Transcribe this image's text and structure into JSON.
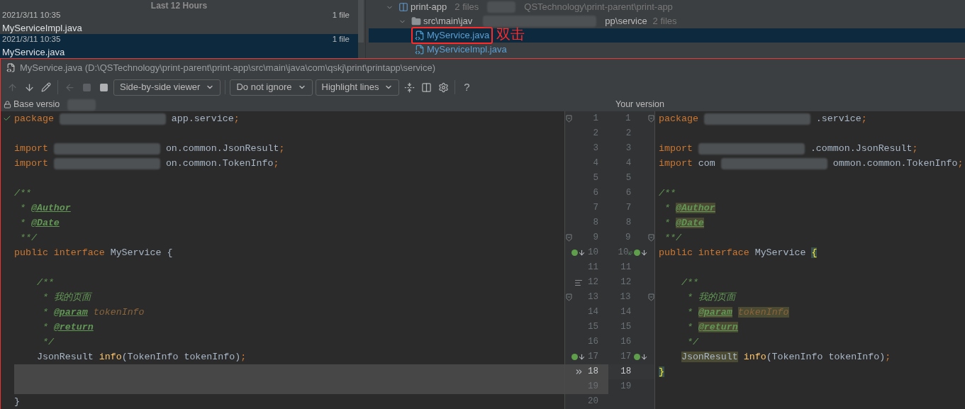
{
  "history": {
    "header": "Last 12 Hours",
    "items": [
      {
        "date": "2021/3/11 10:35",
        "count": "1 file",
        "name": "MyServiceImpl.java",
        "selected": false
      },
      {
        "date": "2021/3/11 10:35",
        "count": "1 file",
        "name": "MyService.java",
        "selected": true
      }
    ]
  },
  "tree": [
    {
      "kind": "module",
      "label": "print-app",
      "count": "2 files",
      "path": "QSTechnology\\print-parent\\print-app",
      "expanded": true,
      "children": [
        {
          "kind": "folder",
          "label": "src\\main\\jav",
          "path": "pp\\service",
          "count": "2 files",
          "expanded": true,
          "children": [
            {
              "kind": "file",
              "label": "MyService.java",
              "selected": true,
              "annotated": true
            },
            {
              "kind": "file",
              "label": "MyServiceImpl.java",
              "selected": false,
              "annotated": false
            }
          ]
        }
      ]
    }
  ],
  "annotation": "双击",
  "diff": {
    "title": "MyService.java",
    "path": "(D:\\QSTechnology\\print-parent\\print-app\\src\\main\\java\\com\\qskj\\print\\printapp\\service)",
    "toolbar": [
      {
        "kind": "up",
        "disabled": true
      },
      {
        "kind": "down",
        "disabled": false
      },
      {
        "kind": "edit",
        "disabled": false
      },
      {
        "kind": "separator"
      },
      {
        "kind": "back",
        "disabled": true
      },
      {
        "kind": "square",
        "disabled": true
      },
      {
        "kind": "square",
        "disabled": false
      },
      {
        "kind": "dropdown",
        "label": "Side-by-side viewer"
      },
      {
        "kind": "separator"
      },
      {
        "kind": "dropdown",
        "label": "Do not ignore"
      },
      {
        "kind": "dropdown",
        "label": "Highlight lines"
      },
      {
        "kind": "collapse"
      },
      {
        "kind": "columns"
      },
      {
        "kind": "settings"
      },
      {
        "kind": "separator"
      },
      {
        "kind": "help",
        "label": "?"
      }
    ],
    "left_header": "Base versio",
    "right_header": "Your version",
    "left_lines": [
      {
        "changed": false,
        "tokens": [
          {
            "kind": "kw",
            "text": "package"
          },
          {
            "kind": "blur"
          },
          {
            "kind": "plain",
            "text": "app.service"
          },
          {
            "kind": "semi",
            "text": ";"
          }
        ]
      },
      {
        "changed": false
      },
      {
        "changed": false,
        "tokens": [
          {
            "kind": "kw",
            "text": "import"
          },
          {
            "kind": "blur"
          },
          {
            "kind": "plain",
            "text": "on.common.JsonResult"
          },
          {
            "kind": "semi",
            "text": ";"
          }
        ]
      },
      {
        "changed": false,
        "tokens": [
          {
            "kind": "kw",
            "text": "import"
          },
          {
            "kind": "blur"
          },
          {
            "kind": "plain",
            "text": "on.common.TokenInfo"
          },
          {
            "kind": "semi",
            "text": ";"
          }
        ]
      },
      {
        "changed": false
      },
      {
        "changed": false,
        "tokens": [
          {
            "kind": "cmt",
            "text": "/**"
          }
        ]
      },
      {
        "changed": false,
        "tokens": [
          {
            "kind": "cmt",
            "text": " * "
          },
          {
            "kind": "tag",
            "text": "@Author"
          }
        ]
      },
      {
        "changed": false,
        "tokens": [
          {
            "kind": "cmt",
            "text": " * "
          },
          {
            "kind": "tag",
            "text": "@Date"
          }
        ]
      },
      {
        "changed": false,
        "tokens": [
          {
            "kind": "cmt",
            "text": " **/"
          }
        ]
      },
      {
        "changed": false,
        "tokens": [
          {
            "kind": "kw",
            "text": "public interface "
          },
          {
            "kind": "plain",
            "text": "MyService {"
          }
        ]
      },
      {
        "changed": false
      },
      {
        "changed": false,
        "tokens": [
          {
            "kind": "cmt",
            "text": "    /**"
          }
        ]
      },
      {
        "changed": false,
        "tokens": [
          {
            "kind": "cmt",
            "text": "     * 我的页面"
          }
        ]
      },
      {
        "changed": false,
        "tokens": [
          {
            "kind": "cmt",
            "text": "     * "
          },
          {
            "kind": "tag",
            "text": "@param"
          },
          {
            "kind": "param",
            "text": " tokenInfo"
          }
        ]
      },
      {
        "changed": false,
        "tokens": [
          {
            "kind": "cmt",
            "text": "     * "
          },
          {
            "kind": "tag",
            "text": "@return"
          }
        ]
      },
      {
        "changed": false,
        "tokens": [
          {
            "kind": "cmt",
            "text": "     */"
          }
        ]
      },
      {
        "changed": false,
        "tokens": [
          {
            "kind": "plain",
            "text": "    JsonResult "
          },
          {
            "kind": "fn",
            "text": "info"
          },
          {
            "kind": "plain",
            "text": "(TokenInfo tokenInfo)"
          },
          {
            "kind": "semi",
            "text": ";"
          }
        ]
      },
      {
        "changed": true
      },
      {
        "changed": true
      },
      {
        "changed": false,
        "tokens": [
          {
            "kind": "plain",
            "text": "}"
          }
        ]
      }
    ],
    "gutter": [
      {
        "base_number": "1",
        "your_number": "1",
        "base_icons": [
          {
            "kind": "fold"
          }
        ],
        "your_icons": [
          {
            "kind": "fold"
          }
        ],
        "current": false,
        "changed": false
      },
      {
        "base_number": "2",
        "your_number": "2",
        "current": false,
        "changed": false
      },
      {
        "base_number": "3",
        "your_number": "3",
        "current": false,
        "changed": false
      },
      {
        "base_number": "4",
        "your_number": "4",
        "current": false,
        "changed": false
      },
      {
        "base_number": "5",
        "your_number": "5",
        "current": false,
        "changed": false
      },
      {
        "base_number": "6",
        "your_number": "6",
        "current": false,
        "changed": false
      },
      {
        "base_number": "7",
        "your_number": "7",
        "current": false,
        "changed": false
      },
      {
        "base_number": "8",
        "your_number": "8",
        "current": false,
        "changed": false
      },
      {
        "base_number": "9",
        "your_number": "9",
        "base_icons": [
          {
            "kind": "fold"
          }
        ],
        "your_icons": [
          {
            "kind": "fold"
          }
        ],
        "current": false,
        "changed": false
      },
      {
        "base_number": "10",
        "your_number": "10",
        "base_icons": [
          {
            "kind": "implemented"
          }
        ],
        "your_icons": [
          {
            "kind": "bean"
          },
          {
            "kind": "implemented"
          }
        ],
        "current": false,
        "changed": false
      },
      {
        "base_number": "11",
        "your_number": "11",
        "current": false,
        "changed": false
      },
      {
        "base_number": "12",
        "your_number": "12",
        "base_icons": [
          {
            "kind": "doc"
          }
        ],
        "current": false,
        "changed": false
      },
      {
        "base_number": "13",
        "your_number": "13",
        "base_icons": [
          {
            "kind": "fold"
          }
        ],
        "your_icons": [
          {
            "kind": "fold"
          }
        ],
        "current": false,
        "changed": false
      },
      {
        "base_number": "14",
        "your_number": "14",
        "current": false,
        "changed": false
      },
      {
        "base_number": "15",
        "your_number": "15",
        "current": false,
        "changed": false
      },
      {
        "base_number": "16",
        "your_number": "16",
        "current": false,
        "changed": false
      },
      {
        "base_number": "17",
        "your_number": "17",
        "base_icons": [
          {
            "kind": "implemented"
          }
        ],
        "your_icons": [
          {
            "kind": "implemented"
          }
        ],
        "current": false,
        "changed": false
      },
      {
        "base_number": "18",
        "your_number": "18",
        "base_icons": [
          {
            "kind": "merge"
          }
        ],
        "current": true,
        "changed": true
      },
      {
        "base_number": "19",
        "your_number": "19",
        "current": false,
        "changed": true
      },
      {
        "base_number": "20",
        "current": false,
        "changed": false
      }
    ],
    "right_lines": [
      {
        "changed": false,
        "tokens": [
          {
            "kind": "kw",
            "text": "package"
          },
          {
            "kind": "blur"
          },
          {
            "kind": "plain",
            "text": ".service"
          },
          {
            "kind": "semi",
            "text": ";"
          }
        ]
      },
      {
        "changed": false
      },
      {
        "changed": false,
        "tokens": [
          {
            "kind": "kw",
            "text": "import"
          },
          {
            "kind": "blur"
          },
          {
            "kind": "plain",
            "text": ".common.JsonResult"
          },
          {
            "kind": "semi",
            "text": ";"
          }
        ]
      },
      {
        "changed": false,
        "tokens": [
          {
            "kind": "kw",
            "text": "import "
          },
          {
            "kind": "plain",
            "text": "com"
          },
          {
            "kind": "blur"
          },
          {
            "kind": "plain",
            "text": "ommon.common.TokenInfo"
          },
          {
            "kind": "semi",
            "text": ";"
          }
        ]
      },
      {
        "changed": false
      },
      {
        "changed": false,
        "tokens": [
          {
            "kind": "cmt",
            "text": "/**"
          }
        ]
      },
      {
        "changed": false,
        "tokens": [
          {
            "kind": "cmt",
            "text": " * "
          },
          {
            "kind": "tag-hl",
            "text": "@Author"
          }
        ]
      },
      {
        "changed": false,
        "tokens": [
          {
            "kind": "cmt",
            "text": " * "
          },
          {
            "kind": "tag-hl",
            "text": "@Date"
          }
        ]
      },
      {
        "changed": false,
        "tokens": [
          {
            "kind": "cmt",
            "text": " **/"
          }
        ]
      },
      {
        "changed": false,
        "tokens": [
          {
            "kind": "kw",
            "text": "public interface "
          },
          {
            "kind": "plain",
            "text": "MyService "
          },
          {
            "kind": "match",
            "text": "{"
          }
        ]
      },
      {
        "changed": false
      },
      {
        "changed": false,
        "tokens": [
          {
            "kind": "cmt",
            "text": "    /**"
          }
        ]
      },
      {
        "changed": false,
        "tokens": [
          {
            "kind": "cmt",
            "text": "     * 我的页面"
          }
        ]
      },
      {
        "changed": false,
        "tokens": [
          {
            "kind": "cmt",
            "text": "     * "
          },
          {
            "kind": "tag-hl",
            "text": "@param"
          },
          {
            "kind": "param-hl",
            "text": " tokenInfo"
          }
        ]
      },
      {
        "changed": false,
        "tokens": [
          {
            "kind": "cmt",
            "text": "     * "
          },
          {
            "kind": "tag-hl",
            "text": "@return"
          }
        ]
      },
      {
        "changed": false,
        "tokens": [
          {
            "kind": "cmt",
            "text": "     */"
          }
        ]
      },
      {
        "changed": false,
        "tokens": [
          {
            "kind": "plain-hl",
            "text": "    JsonResult"
          },
          {
            "kind": "fn",
            "text": " info"
          },
          {
            "kind": "plain",
            "text": "(TokenInfo tokenInfo)"
          },
          {
            "kind": "semi",
            "text": ";"
          }
        ]
      },
      {
        "changed": false,
        "tokens": [
          {
            "kind": "match",
            "text": "}"
          }
        ]
      },
      {
        "changed": false
      }
    ]
  }
}
